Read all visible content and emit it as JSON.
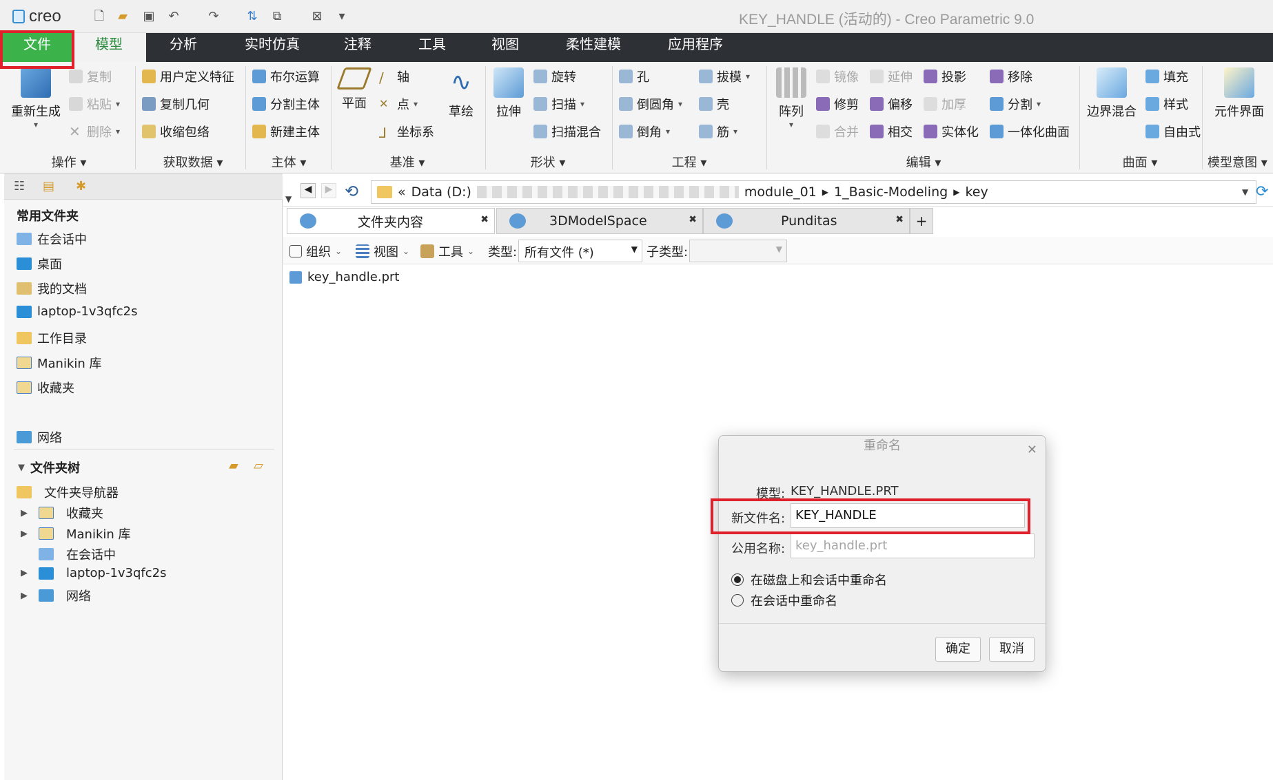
{
  "titlebar": {
    "logo": "creo",
    "window_title": "KEY_HANDLE (活动的) - Creo Parametric 9.0"
  },
  "tabs": [
    {
      "label": "文件"
    },
    {
      "label": "模型"
    },
    {
      "label": "分析"
    },
    {
      "label": "实时仿真"
    },
    {
      "label": "注释"
    },
    {
      "label": "工具"
    },
    {
      "label": "视图"
    },
    {
      "label": "柔性建模"
    },
    {
      "label": "应用程序"
    }
  ],
  "ribbon": {
    "groups": {
      "operations": "操作",
      "get_data": "获取数据",
      "body": "主体",
      "datum": "基准",
      "shapes": "形状",
      "engineering": "工程",
      "editing": "编辑",
      "surfaces": "曲面",
      "model_intent": "模型意图"
    },
    "regenerate": "重新生成",
    "copy": "复制",
    "paste": "粘贴",
    "delete": "删除",
    "udf": "用户定义特征",
    "copy_geom": "复制几何",
    "shrinkwrap": "收缩包络",
    "boolean": "布尔运算",
    "split_body": "分割主体",
    "new_body": "新建主体",
    "plane": "平面",
    "axis": "轴",
    "point": "点",
    "csys": "坐标系",
    "sketch": "草绘",
    "extrude": "拉伸",
    "revolve": "旋转",
    "sweep": "扫描",
    "swept_blend": "扫描混合",
    "hole": "孔",
    "round": "倒圆角",
    "chamfer": "倒角",
    "draft": "拔模",
    "shell": "壳",
    "rib": "筋",
    "pattern": "阵列",
    "mirror": "镜像",
    "trim": "修剪",
    "merge": "合并",
    "extend": "延伸",
    "offset": "偏移",
    "intersect": "相交",
    "project": "投影",
    "thicken": "加厚",
    "solidify": "实体化",
    "remove": "移除",
    "split": "分割",
    "unify_surface": "一体化曲面",
    "boundary_blend": "边界混合",
    "fill": "填充",
    "style": "样式",
    "freestyle": "自由式",
    "component_interface": "元件界面"
  },
  "sidebar": {
    "common_title": "常用文件夹",
    "common": [
      {
        "label": "在会话中"
      },
      {
        "label": "桌面"
      },
      {
        "label": "我的文档"
      },
      {
        "label": "laptop-1v3qfc2s"
      },
      {
        "label": "工作目录"
      },
      {
        "label": "Manikin 库"
      },
      {
        "label": "收藏夹"
      }
    ],
    "network": "网络",
    "tree_title": "文件夹树",
    "tree": [
      {
        "label": "文件夹导航器"
      },
      {
        "label": "收藏夹"
      },
      {
        "label": "Manikin 库"
      },
      {
        "label": "在会话中"
      },
      {
        "label": "laptop-1v3qfc2s"
      },
      {
        "label": "网络"
      }
    ]
  },
  "browser": {
    "path": [
      "«",
      "Data (D:)",
      "module_01",
      "1_Basic-Modeling",
      "key"
    ],
    "tabs": [
      {
        "label": "文件夹内容"
      },
      {
        "label": "3DModelSpace"
      },
      {
        "label": "Punditas"
      }
    ],
    "toolbar": {
      "organize": "组织",
      "view": "视图",
      "tools": "工具",
      "type_label": "类型:",
      "type_value": "所有文件 (*)",
      "subtype_label": "子类型:"
    },
    "files": [
      {
        "name": "key_handle.prt"
      }
    ]
  },
  "dialog": {
    "title": "重命名",
    "model_label": "模型:",
    "model_value": "KEY_HANDLE.PRT",
    "new_name_label": "新文件名:",
    "new_name_value": "KEY_HANDLE",
    "common_name_label": "公用名称:",
    "common_name_placeholder": "key_handle.prt",
    "radio1": "在磁盘上和会话中重命名",
    "radio2": "在会话中重命名",
    "ok": "确定",
    "cancel": "取消"
  },
  "colors": {
    "file_tab": "#3bb34a",
    "tab_bar": "#2d3035",
    "highlight": "#e0202a"
  }
}
